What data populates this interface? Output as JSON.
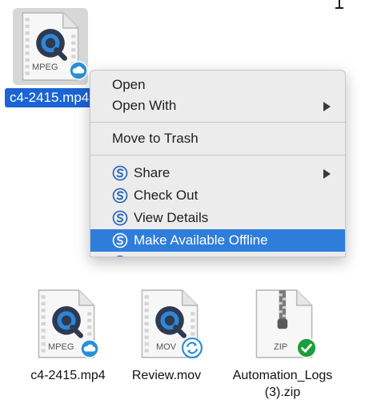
{
  "selected_file": {
    "name": "c4-2415.mp4",
    "type_label": "MPEG"
  },
  "context_menu": {
    "items": [
      {
        "label": "Open"
      },
      {
        "label": "Open With",
        "submenu": true
      },
      {
        "label": "Move to Trash"
      },
      {
        "label": "Share",
        "icon": "sync-s-icon",
        "submenu": true
      },
      {
        "label": "Check Out",
        "icon": "sync-s-icon"
      },
      {
        "label": "View Details",
        "icon": "sync-s-icon"
      },
      {
        "label": "Make Available Offline",
        "icon": "sync-s-icon",
        "highlighted": true
      }
    ]
  },
  "files": [
    {
      "name": "c4-2415.mp4",
      "type_label": "MPEG",
      "status_icon": "cloud-icon",
      "status": "online-only"
    },
    {
      "name": "Review.mov",
      "type_label": "MOV",
      "status_icon": "sync-icon",
      "status": "syncing"
    },
    {
      "name_line1": "Automation_Logs",
      "name_line2": "(3).zip",
      "type_label": "ZIP",
      "status_icon": "checkmark-icon",
      "status": "available-offline"
    }
  ],
  "colors": {
    "selection_blue": "#1b64d4",
    "menu_highlight": "#2f7ddb",
    "cloud_blue": "#2a8fd6",
    "check_green": "#1e9e3a",
    "brand_s": "#1d5fb8"
  }
}
